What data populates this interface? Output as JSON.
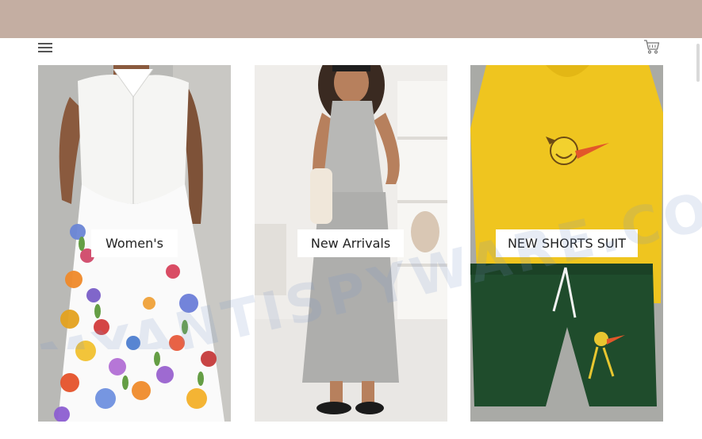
{
  "header": {
    "menu_icon": "hamburger-menu-icon",
    "cart_icon": "shopping-cart-icon"
  },
  "collections": [
    {
      "label": "Women's"
    },
    {
      "label": "New Arrivals"
    },
    {
      "label": "NEW SHORTS SUIT"
    }
  ],
  "watermark": {
    "text": "MYANTISPYWARE.COM"
  },
  "colors": {
    "announcement_bar": "#c4aea2",
    "label_background": "#ffffff",
    "label_text": "#222222"
  }
}
